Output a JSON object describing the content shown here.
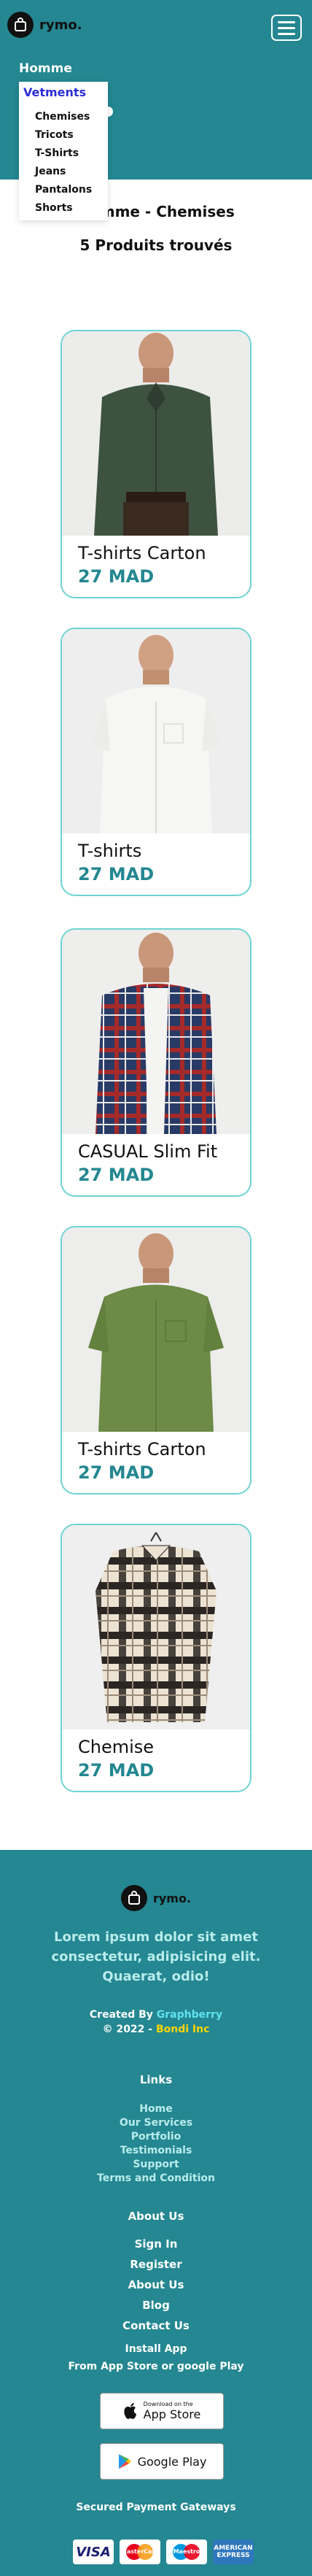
{
  "header": {
    "logo_text": "rymo.",
    "nav_top": "Homme",
    "dropdown_head": "Vetments",
    "dropdown_items": [
      "Chemises",
      "Tricots",
      "T-Shirts",
      "Jeans",
      "Pantalons",
      "Shorts"
    ]
  },
  "page": {
    "title": "Homme - Chemises",
    "count": "5 Produits trouvés"
  },
  "products": [
    {
      "name": "T-shirts Carton",
      "price": "27 MAD"
    },
    {
      "name": "T-shirts",
      "price": "27 MAD"
    },
    {
      "name": "CASUAL Slim Fit",
      "price": "27 MAD"
    },
    {
      "name": "T-shirts Carton",
      "price": "27 MAD"
    },
    {
      "name": "Chemise",
      "price": "27 MAD"
    }
  ],
  "footer": {
    "logo_text": "rymo.",
    "lorem": "Lorem ipsum dolor sit amet consectetur, adipisicing elit. Quaerat, odio!",
    "created_by_prefix": "Created By ",
    "created_by_name": "Graphberry",
    "copyright_prefix": "© 2022 - ",
    "copyright_name": "Bondi Inc",
    "links_title": "Links",
    "links": [
      "Home",
      "Our Services",
      "Portfolio",
      "Testimonials",
      "Support",
      "Terms and Condition"
    ],
    "about_title": "About Us",
    "about_links": [
      "Sign In",
      "Register",
      "About Us",
      "Blog",
      "Contact Us"
    ],
    "install_title": "Install App",
    "install_sub": "From App Store or google Play",
    "appstore_small": "Download on the",
    "appstore_big": "App Store",
    "googleplay": "Google Play",
    "payment_title": "Secured Payment Gateways",
    "payments": [
      "VISA",
      "MasterCard",
      "Maestro",
      "AMERICAN EXPRESS"
    ]
  },
  "colors": {
    "primary": "#248791",
    "card_border": "#6fd3d3",
    "price": "#248791",
    "dropdown_head": "#2b2fd6"
  }
}
